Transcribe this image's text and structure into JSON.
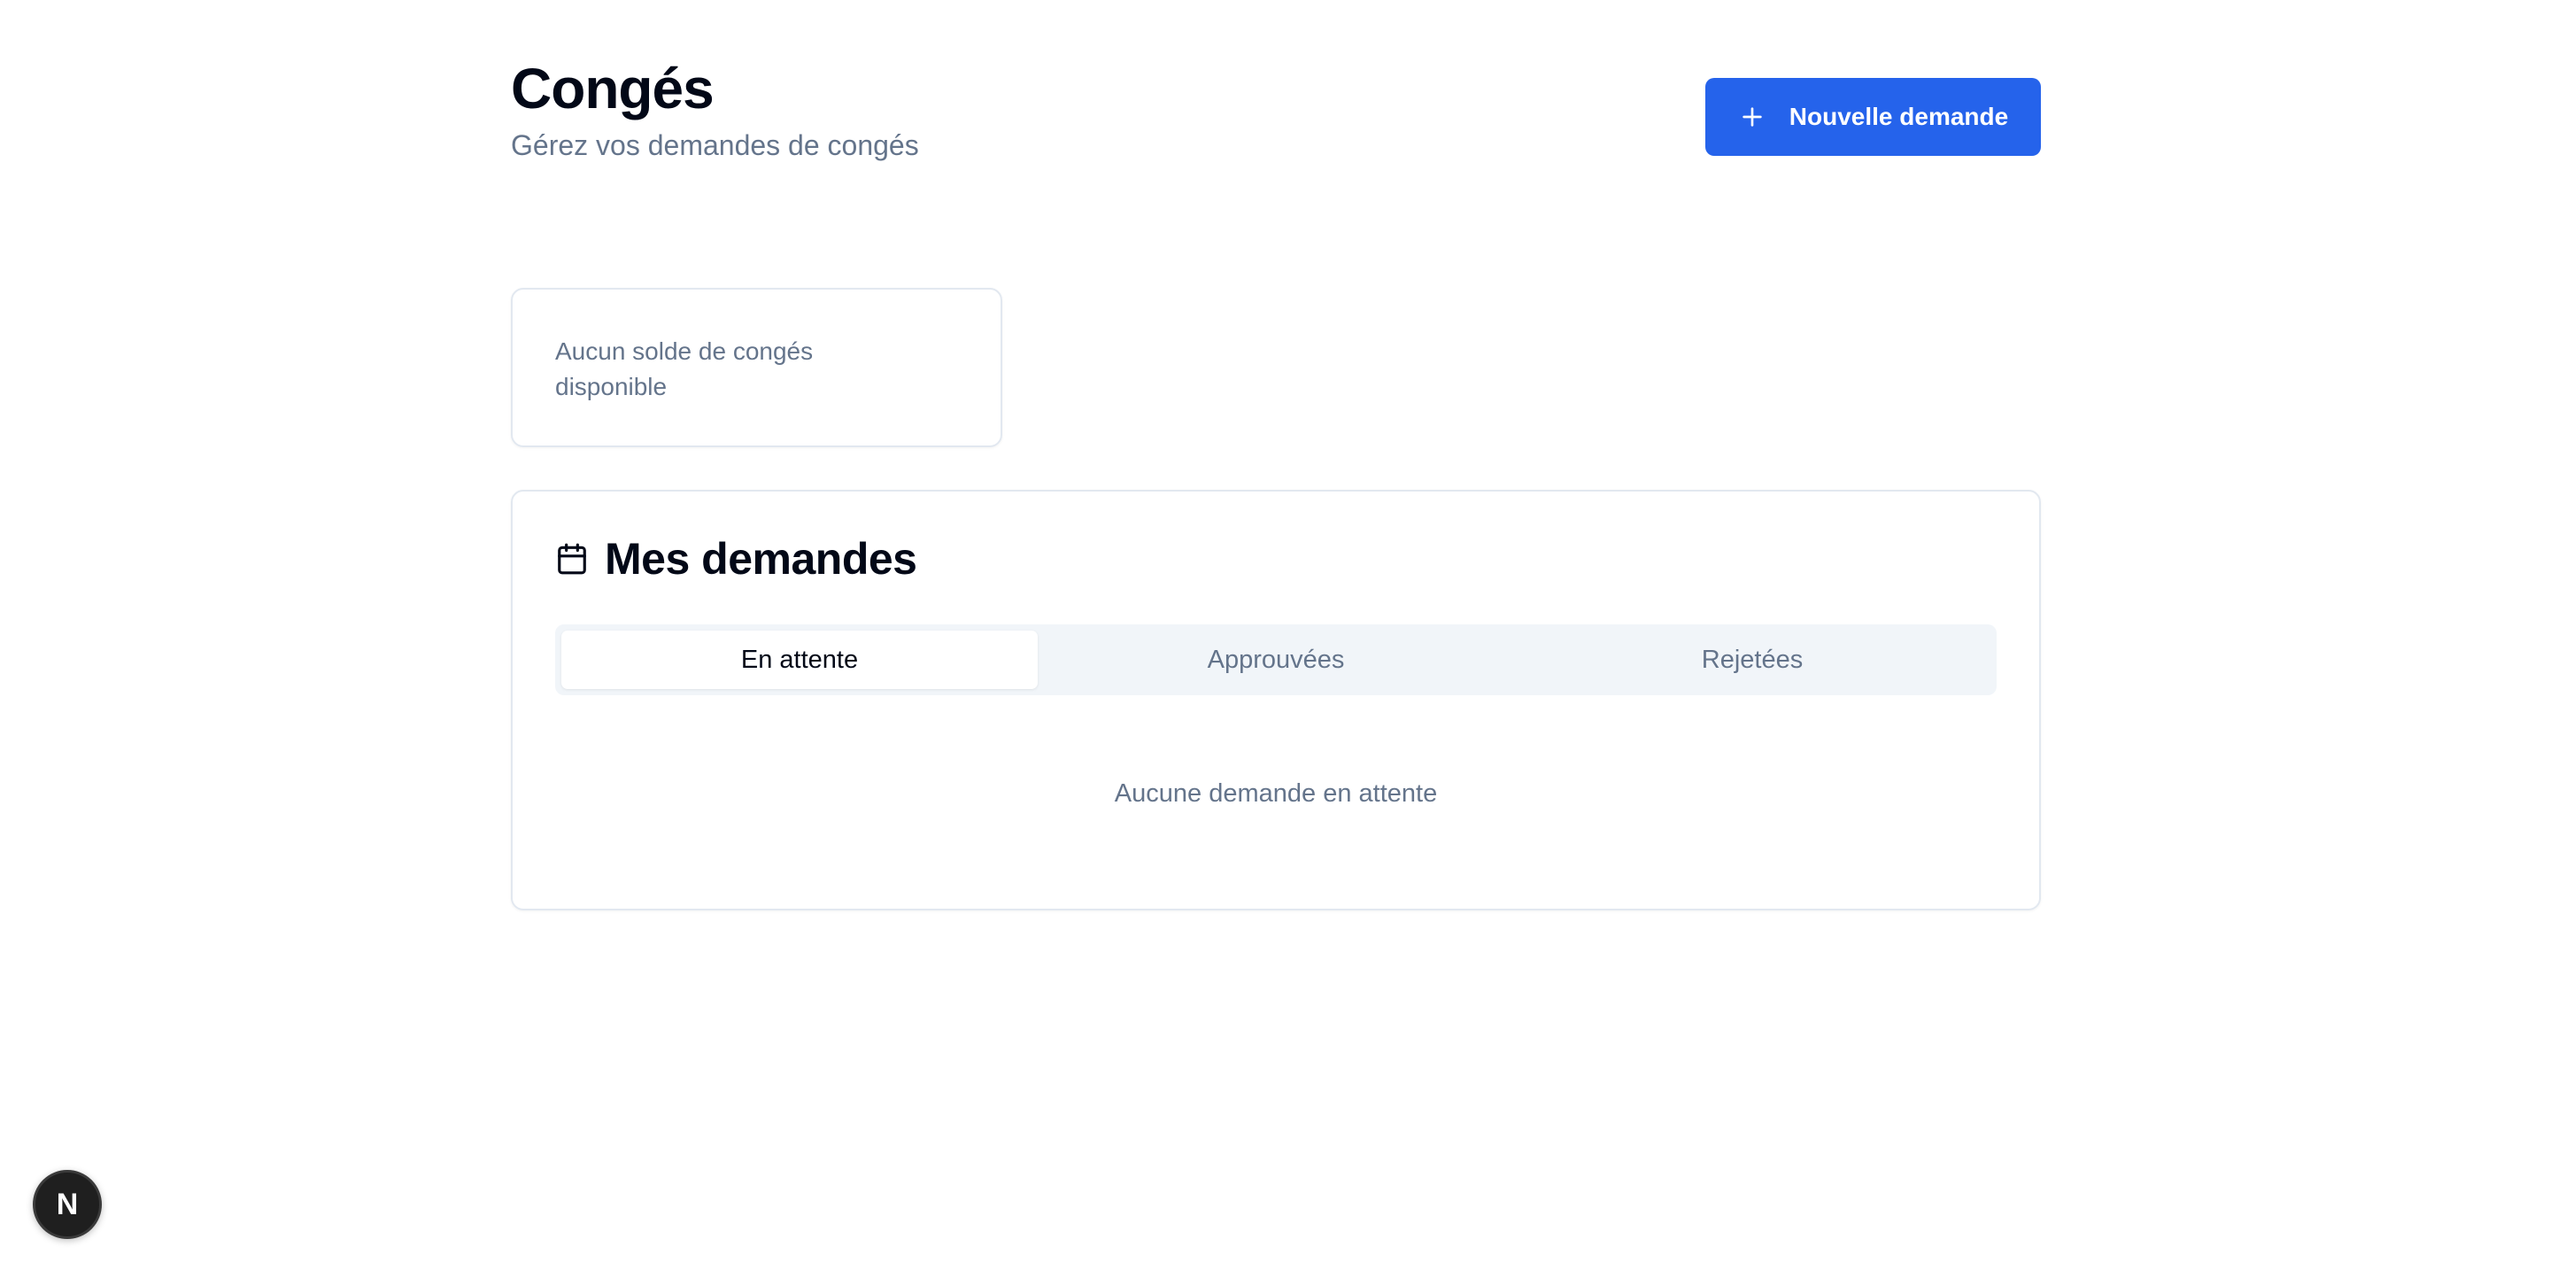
{
  "header": {
    "title": "Congés",
    "subtitle": "Gérez vos demandes de congés",
    "new_request_label": "Nouvelle demande"
  },
  "balance": {
    "empty_text": "Aucun solde de congés disponible"
  },
  "requests": {
    "title": "Mes demandes",
    "tabs": [
      {
        "label": "En attente",
        "active": true
      },
      {
        "label": "Approuvées",
        "active": false
      },
      {
        "label": "Rejetées",
        "active": false
      }
    ],
    "empty_text": "Aucune demande en attente"
  },
  "badge": {
    "letter": "N"
  },
  "colors": {
    "accent": "#2563eb",
    "muted_text": "#64748b",
    "border": "#e2e8f0",
    "tab_bg": "#f1f5f9"
  },
  "icons": [
    "plus-icon",
    "calendar-icon",
    "nextjs-logo-icon"
  ]
}
